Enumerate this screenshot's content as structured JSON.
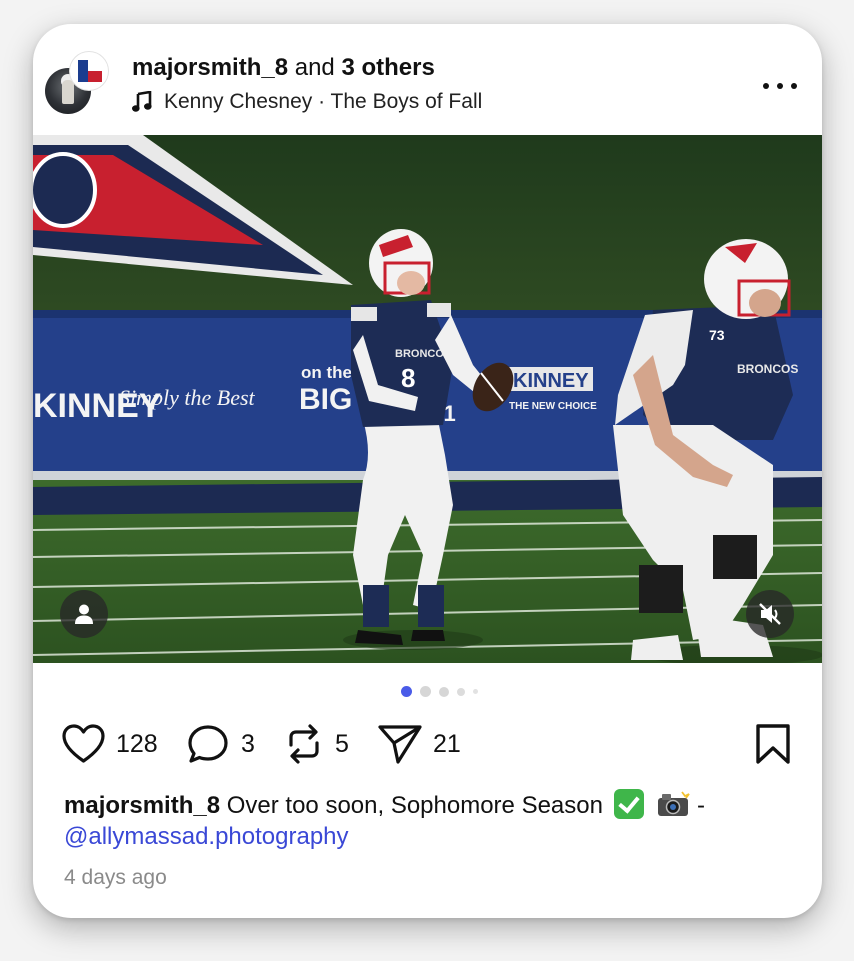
{
  "post": {
    "author": "majorsmith_8",
    "coauthors_text": "and",
    "others": "3 others",
    "music": "Kenny Chesney · The Boys of Fall",
    "more_icon": "more-horizontal-icon"
  },
  "photo": {
    "jersey_text": "BRONCOS",
    "banner_words": [
      "KINNEY",
      "Simply the Best",
      "on the",
      "BIG",
      "121",
      "KINNEY",
      "THE NEW CHOICE"
    ],
    "player_number": "73",
    "page_dots": 5,
    "active_dot": 0
  },
  "actions": {
    "likes": "128",
    "comments": "3",
    "reposts": "5",
    "shares": "21"
  },
  "caption": {
    "user": "majorsmith_8",
    "text": " Over too soon, Sophomore Season ",
    "dash": " -",
    "mention": "@allymassad.photography"
  },
  "timestamp": "4 days ago",
  "colors": {
    "accent_dot": "#4a5be8",
    "mention": "#3a48d6"
  }
}
